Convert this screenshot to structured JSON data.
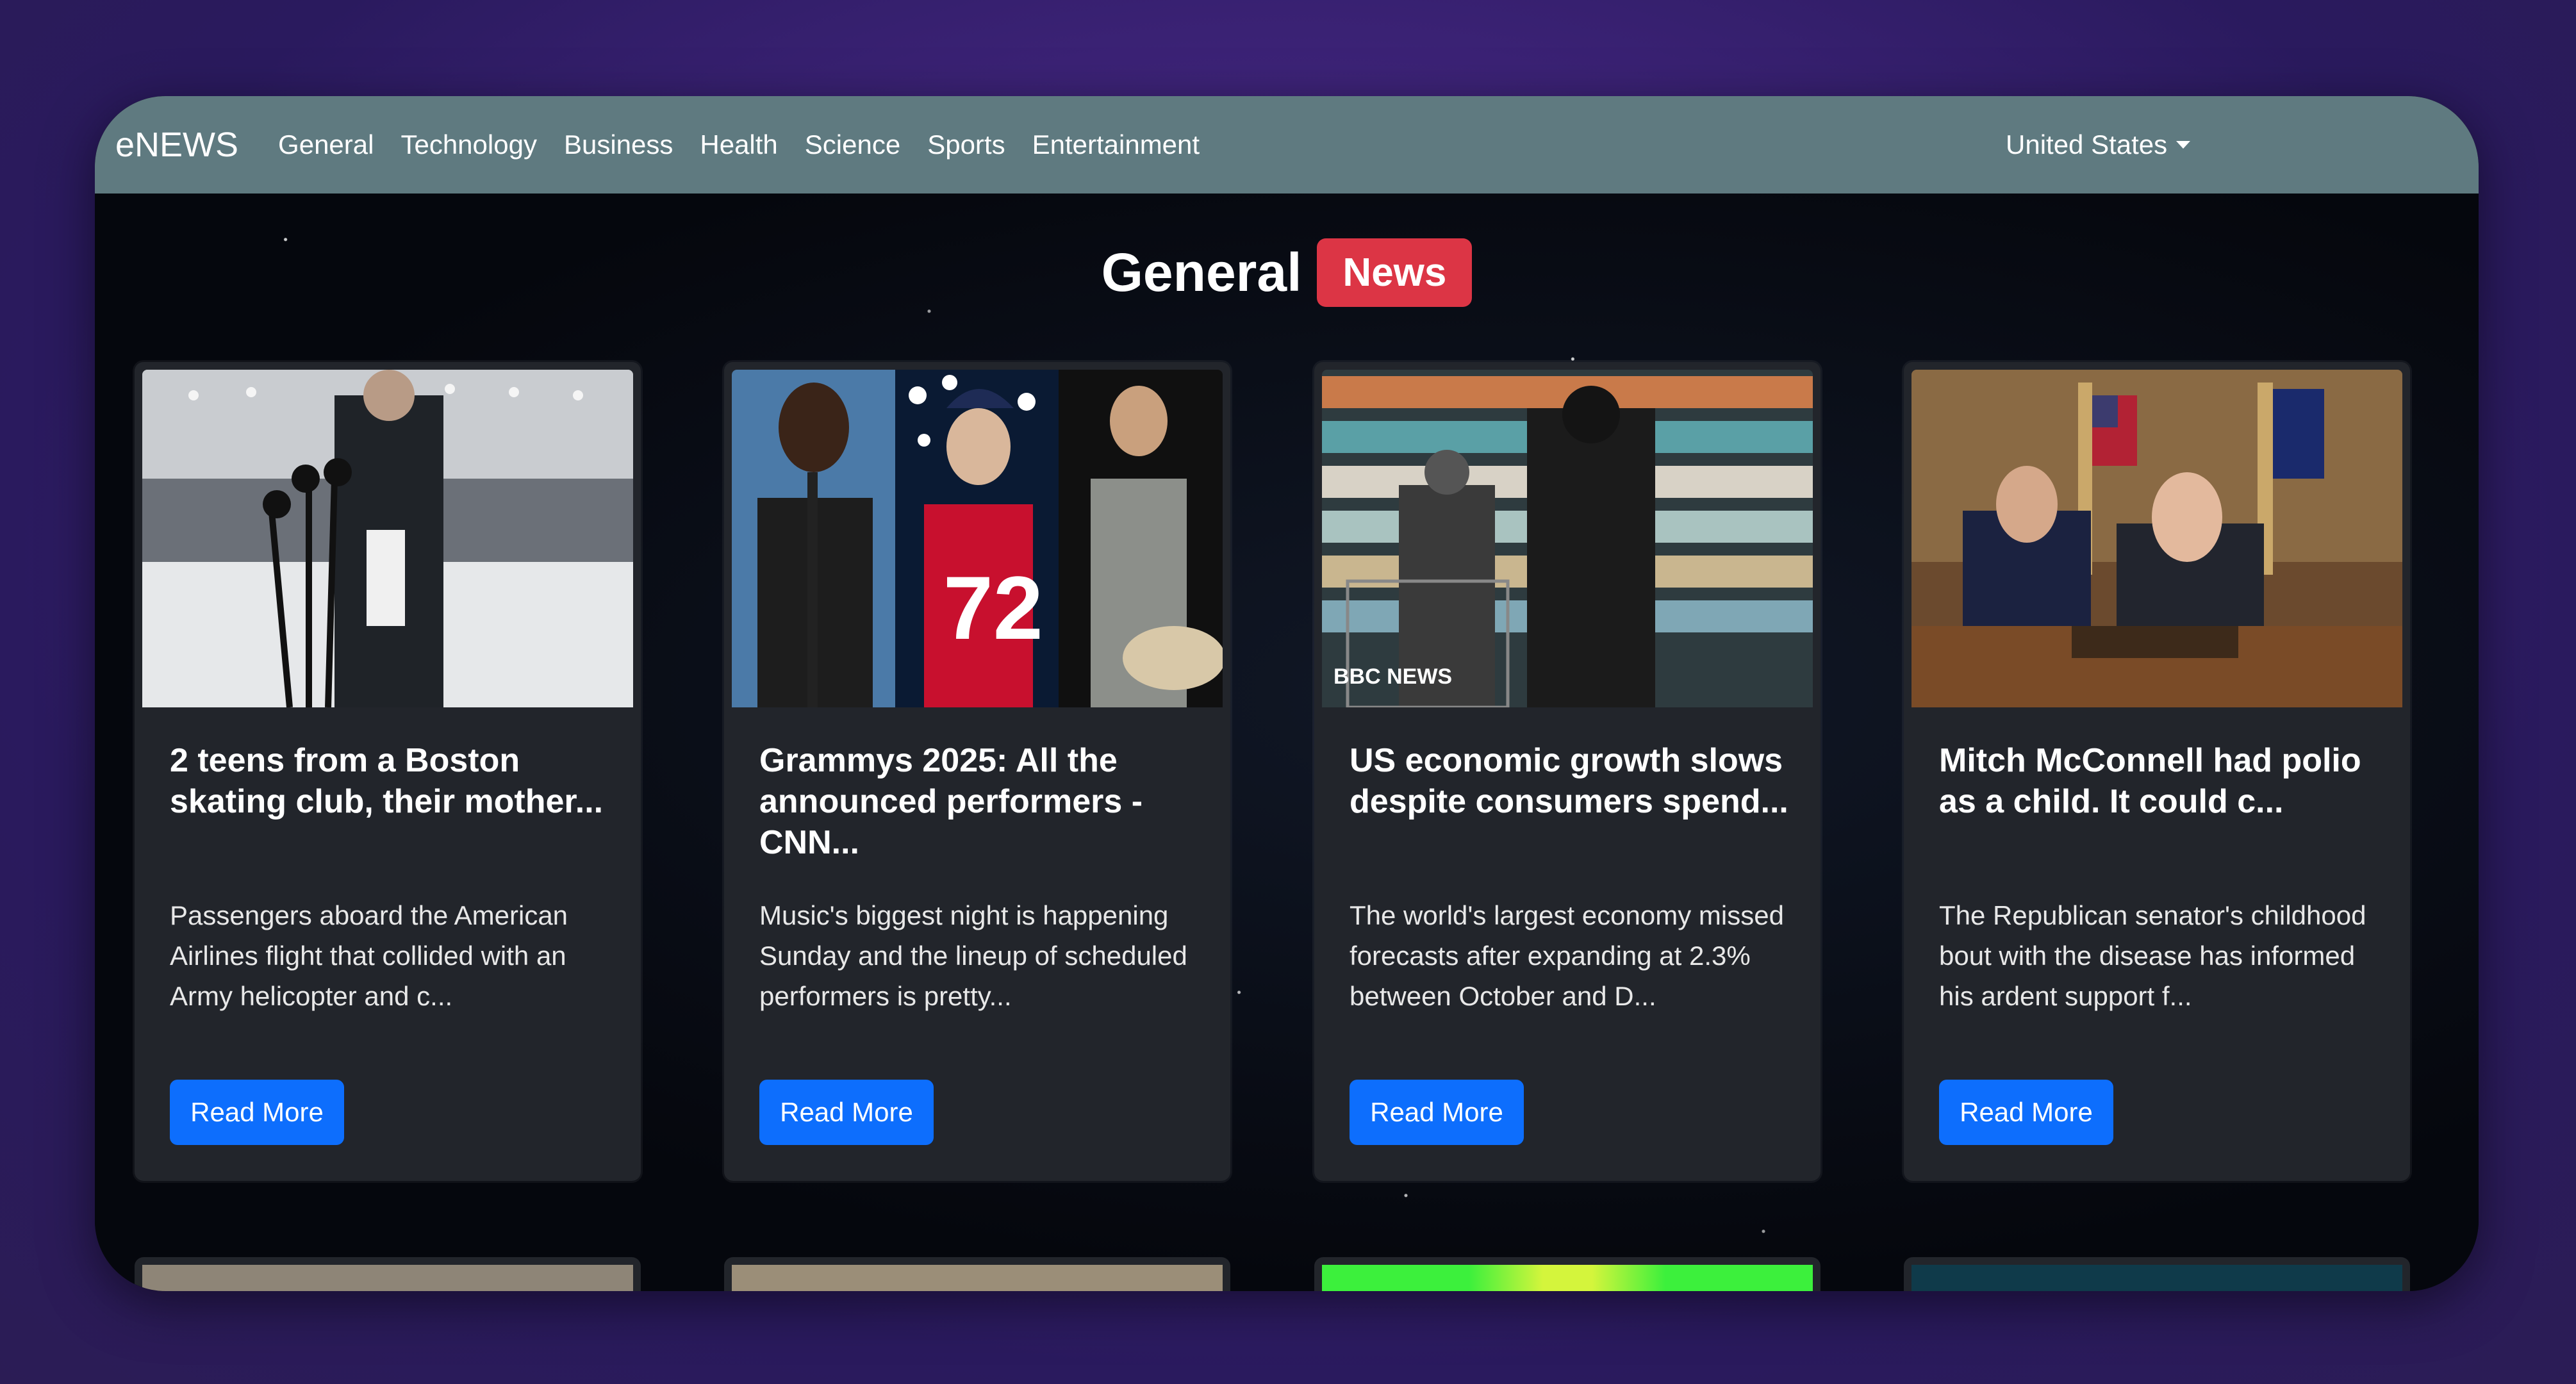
{
  "navbar": {
    "brand": "eNEWS",
    "items": [
      "General",
      "Technology",
      "Business",
      "Health",
      "Science",
      "Sports",
      "Entertainment"
    ],
    "country": "United States"
  },
  "heading": {
    "title": "General",
    "badge": "News"
  },
  "cards": [
    {
      "title": "2 teens from a Boston skating club, their mother...",
      "description": "Passengers aboard the American Airlines flight that collided with an Army helicopter and c...",
      "button": "Read More"
    },
    {
      "title": "Grammys 2025: All the announced performers - CNN...",
      "description": "Music's biggest night is happening Sunday and the lineup of scheduled performers is pretty...",
      "button": "Read More"
    },
    {
      "title": "US economic growth slows despite consumers spend...",
      "description": "The world's largest economy missed forecasts after expanding at 2.3% between October and D...",
      "button": "Read More",
      "image_logo": "BBC NEWS"
    },
    {
      "title": "Mitch McConnell had polio as a child. It could c...",
      "description": "The Republican senator's childhood bout with the disease has informed his ardent support f...",
      "button": "Read More"
    }
  ],
  "colors": {
    "navbar": "#5f7a80",
    "badge": "#dc3545",
    "button": "#0d6efd",
    "card": "#22252b"
  }
}
